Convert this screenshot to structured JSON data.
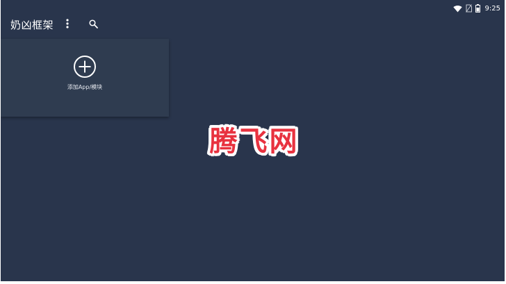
{
  "status_bar": {
    "time": "9:25",
    "icons": [
      "wifi-icon",
      "no-sim-icon",
      "battery-icon"
    ]
  },
  "app_bar": {
    "title": "奶凶框架",
    "icons": [
      "more-vert-icon",
      "search-icon"
    ]
  },
  "add_card": {
    "label": "添加App/模块",
    "icon": "add-circle-icon"
  },
  "watermark": {
    "text": "腾飞网",
    "color": "#e8323f"
  },
  "colors": {
    "background": "#29354c",
    "card": "#2f3c50",
    "text": "#ffffff"
  }
}
